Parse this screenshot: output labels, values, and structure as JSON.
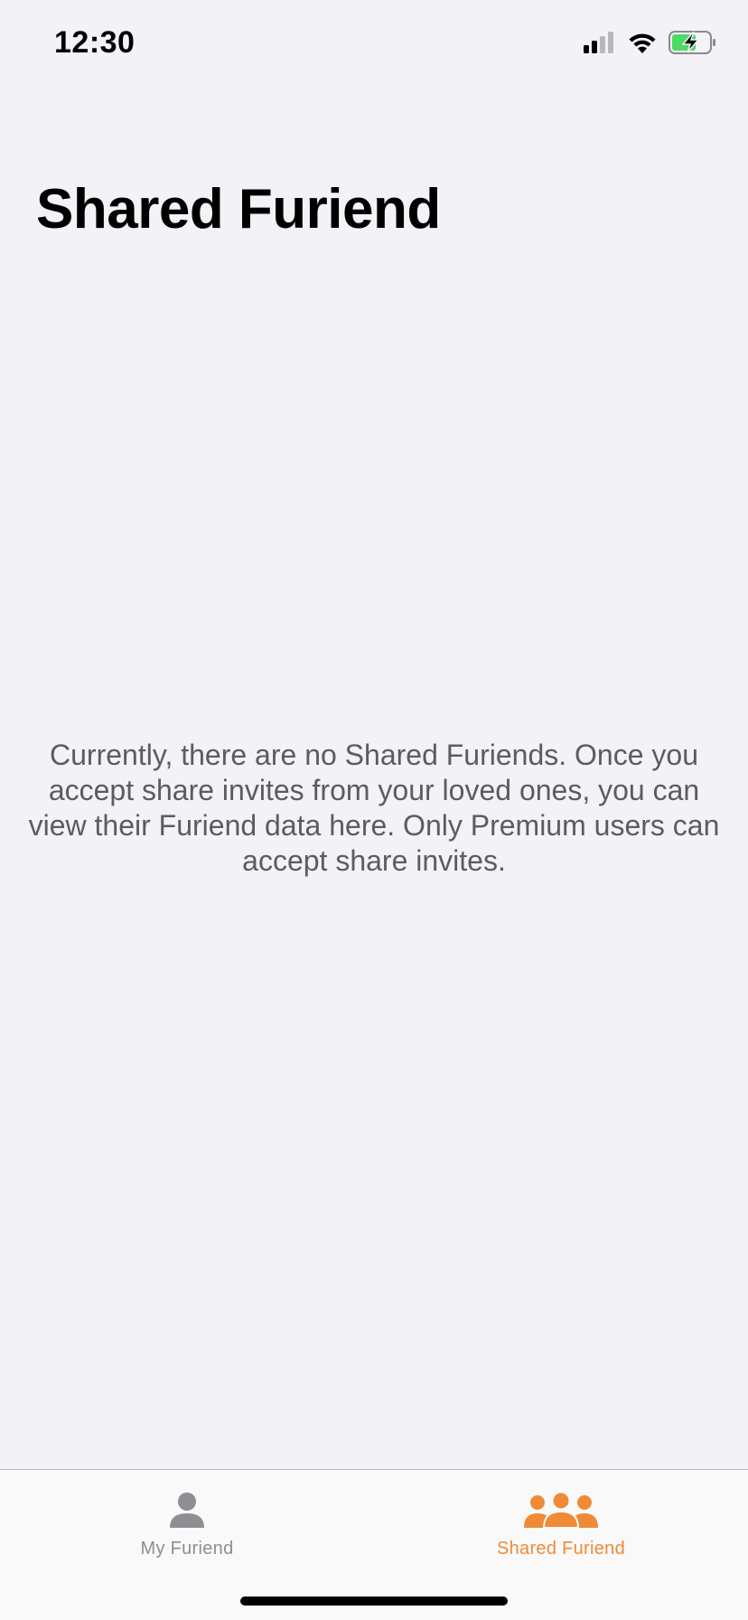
{
  "status_bar": {
    "time": "12:30"
  },
  "page": {
    "title": "Shared Furiend",
    "empty_message": "Currently, there are no Shared Furiends. Once you accept share invites from your loved ones, you can view their Furiend data here. Only Premium users can accept share invites."
  },
  "tab_bar": {
    "tabs": [
      {
        "label": "My Furiend",
        "icon": "person-icon",
        "selected": false
      },
      {
        "label": "Shared Furiend",
        "icon": "group-icon",
        "selected": true
      }
    ]
  },
  "colors": {
    "accent": "#ef8a37",
    "inactive": "#8e8e93",
    "background": "#f2f2f7",
    "battery_fill": "#4cd964"
  }
}
